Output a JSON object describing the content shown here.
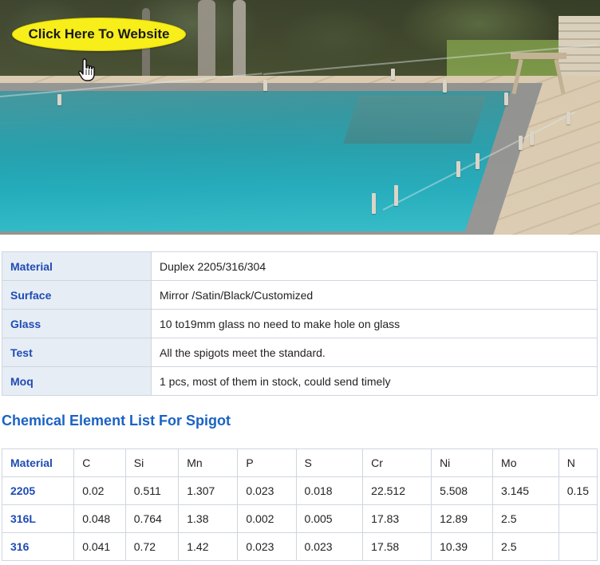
{
  "hero": {
    "cta_label": "Click Here To Website"
  },
  "specs": [
    {
      "label": "Material",
      "value": "Duplex 2205/316/304"
    },
    {
      "label": "Surface",
      "value": "Mirror /Satin/Black/Customized"
    },
    {
      "label": "Glass",
      "value": "10 to19mm glass no need to make hole on glass"
    },
    {
      "label": "Test",
      "value": "All the spigots meet the standard."
    },
    {
      "label": "Moq",
      "value": "1 pcs, most of them in stock, could send timely"
    }
  ],
  "chemical": {
    "title": "Chemical Element List For Spigot",
    "headers": [
      "Material",
      "C",
      "Si",
      "Mn",
      "P",
      "S",
      "Cr",
      "Ni",
      "Mo",
      "N"
    ],
    "rows": [
      [
        "2205",
        "0.02",
        "0.511",
        "1.307",
        "0.023",
        "0.018",
        "22.512",
        "5.508",
        "3.145",
        "0.15"
      ],
      [
        "316L",
        "0.048",
        "0.764",
        "1.38",
        "0.002",
        "0.005",
        "17.83",
        "12.89",
        "2.5",
        ""
      ],
      [
        "316",
        "0.041",
        "0.72",
        "1.42",
        "0.023",
        "0.023",
        "17.58",
        "10.39",
        "2.5",
        ""
      ]
    ]
  }
}
